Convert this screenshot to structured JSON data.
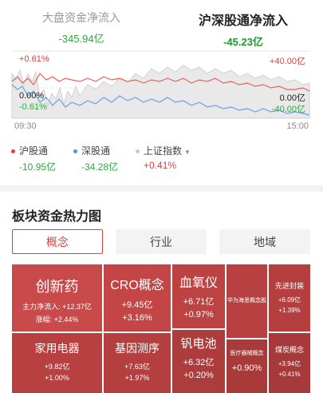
{
  "top_tabs": {
    "market": {
      "title": "大盘资金净流入",
      "value": "-345.94亿"
    },
    "hk_connect": {
      "title": "沪深股通净流入",
      "value": "-45.23亿"
    }
  },
  "chart": {
    "left_top": "+0.61%",
    "left_mid": "0.00%",
    "left_bottom": "-0.61%",
    "right_top": "+40.00亿",
    "right_mid": "0.00亿",
    "right_bottom": "-40.00亿",
    "time_start": "09:30",
    "time_end": "15:00",
    "colors": {
      "sh": "#e8625c",
      "sz": "#6b9ee8",
      "index": "#cfcfcf"
    }
  },
  "legend": [
    {
      "label": "沪股通",
      "value": "-10.95亿",
      "color": "#e23d3d"
    },
    {
      "label": "深股通",
      "value": "-34.28亿",
      "color": "#5b8fe0"
    },
    {
      "label": "上证指数",
      "value": "+0.41%",
      "color": "#c8c8c8"
    }
  ],
  "heatmap": {
    "title": "板块资金热力图",
    "segments": [
      "概念",
      "行业",
      "地域"
    ],
    "cells": [
      {
        "name": "创新药",
        "line1": "主力净流入: +12.37亿",
        "line2": "涨幅: +2.44%"
      },
      {
        "name": "CRO概念",
        "line1": "+9.45亿",
        "line2": "+3.16%"
      },
      {
        "name": "血氧仪",
        "line1": "+6.71亿",
        "line2": "+0.97%"
      },
      {
        "name": "华为海思概念股",
        "line1": "",
        "line2": ""
      },
      {
        "name": "先进封装",
        "line1": "+6.09亿",
        "line2": "+1.39%"
      },
      {
        "name": "家用电器",
        "line1": "+9.82亿",
        "line2": "+1.00%"
      },
      {
        "name": "基因测序",
        "line1": "+7.63亿",
        "line2": "+1.97%"
      },
      {
        "name": "钒电池",
        "line1": "+6.32亿",
        "line2": "+0.20%"
      },
      {
        "name": "医疗器械概念",
        "line1": "+0.90%",
        "line2": ""
      },
      {
        "name": "煤炭概念",
        "line1": "+3.94亿",
        "line2": "+0.41%"
      }
    ]
  }
}
